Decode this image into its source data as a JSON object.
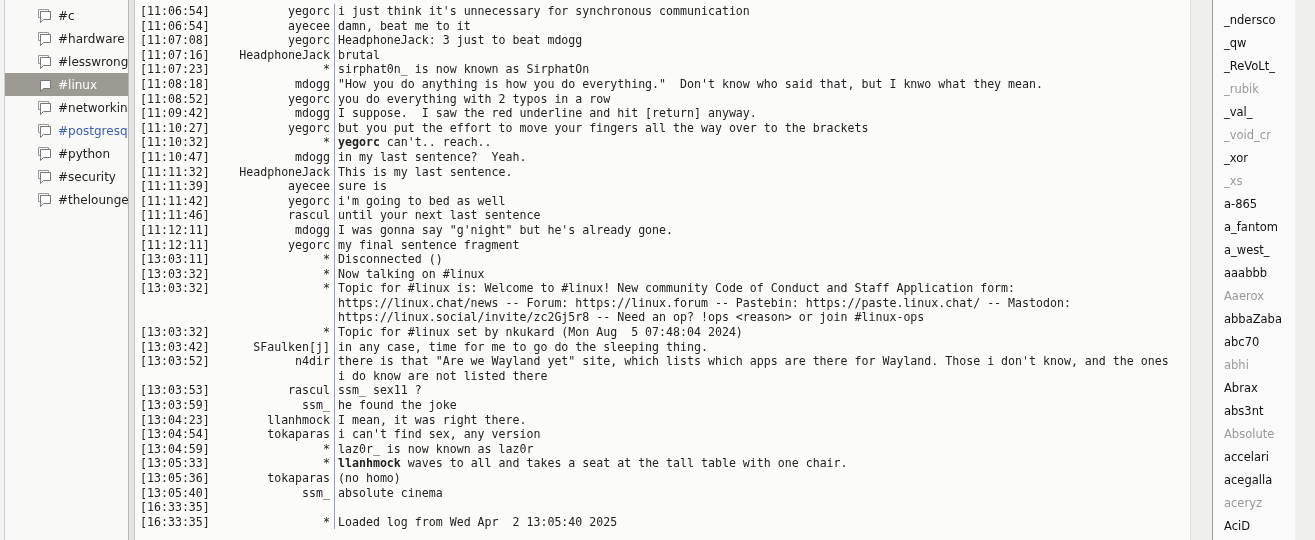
{
  "channels": [
    {
      "name": "#c",
      "selected": false,
      "highlighted": false
    },
    {
      "name": "#hardware",
      "selected": false,
      "highlighted": false
    },
    {
      "name": "#lesswrong",
      "selected": false,
      "highlighted": false
    },
    {
      "name": "#linux",
      "selected": true,
      "highlighted": false
    },
    {
      "name": "#networkin",
      "selected": false,
      "highlighted": false
    },
    {
      "name": "#postgresq",
      "selected": false,
      "highlighted": true
    },
    {
      "name": "#python",
      "selected": false,
      "highlighted": false
    },
    {
      "name": "#security",
      "selected": false,
      "highlighted": false
    },
    {
      "name": "#thelounge",
      "selected": false,
      "highlighted": false
    }
  ],
  "messages": [
    {
      "time": "[11:06:54]",
      "nick": "yegorc",
      "text": "i just think it's unnecessary for synchronous communication"
    },
    {
      "time": "[11:06:54]",
      "nick": "ayecee",
      "text": "damn, beat me to it"
    },
    {
      "time": "[11:07:08]",
      "nick": "yegorc",
      "text": "HeadphoneJack: 3 just to beat mdogg"
    },
    {
      "time": "[11:07:16]",
      "nick": "HeadphoneJack",
      "text": "brutal"
    },
    {
      "time": "[11:07:23]",
      "nick": "*",
      "text": "sirphat0n_ is now known as SirphatOn"
    },
    {
      "time": "[11:08:18]",
      "nick": "mdogg",
      "text": "\"How you do anything is how you do everything.\"  Don't know who said that, but I knwo what they mean."
    },
    {
      "time": "[11:08:52]",
      "nick": "yegorc",
      "text": "you do everything with 2 typos in a row"
    },
    {
      "time": "[11:09:42]",
      "nick": "mdogg",
      "text": "I suppose.  I saw the red underline and hit [return] anyway."
    },
    {
      "time": "[11:10:27]",
      "nick": "yegorc",
      "text": "but you put the effort to move your fingers all the way over to the brackets"
    },
    {
      "time": "[11:10:32]",
      "nick": "*",
      "text": "**yegorc** can't.. reach.."
    },
    {
      "time": "[11:10:47]",
      "nick": "mdogg",
      "text": "in my last sentence?  Yeah."
    },
    {
      "time": "[11:11:32]",
      "nick": "HeadphoneJack",
      "text": "This is my last sentence."
    },
    {
      "time": "[11:11:39]",
      "nick": "ayecee",
      "text": "sure is"
    },
    {
      "time": "[11:11:42]",
      "nick": "yegorc",
      "text": "i'm going to bed as well"
    },
    {
      "time": "[11:11:46]",
      "nick": "rascul",
      "text": "until your next last sentence"
    },
    {
      "time": "[11:12:11]",
      "nick": "mdogg",
      "text": "I was gonna say \"g'night\" but he's already gone."
    },
    {
      "time": "[11:12:11]",
      "nick": "yegorc",
      "text": "my final sentence fragment"
    },
    {
      "time": "[13:03:11]",
      "nick": "*",
      "text": "Disconnected ()"
    },
    {
      "time": "[13:03:32]",
      "nick": "*",
      "text": "Now talking on #linux"
    },
    {
      "time": "[13:03:32]",
      "nick": "*",
      "text": "Topic for #linux is: Welcome to #linux! New community Code of Conduct and Staff Application form: https://linux.chat/news -- Forum: https://linux.forum -- Pastebin: https://paste.linux.chat/ -- Mastodon: https://linux.social/invite/zc2Gj5r8 -- Need an op? !ops <reason> or join #linux-ops"
    },
    {
      "time": "[13:03:32]",
      "nick": "*",
      "text": "Topic for #linux set by nkukard (Mon Aug  5 07:48:04 2024)"
    },
    {
      "time": "[13:03:42]",
      "nick": "SFaulken[j]",
      "text": "in any case, time for me to go do the sleeping thing."
    },
    {
      "time": "[13:03:52]",
      "nick": "n4dir",
      "text": "there is that \"Are we Wayland yet\" site, which lists which apps are there for Wayland. Those i don't know, and the ones i do know are not listed there"
    },
    {
      "time": "[13:03:53]",
      "nick": "rascul",
      "text": "ssm_ sex11 ?"
    },
    {
      "time": "[13:03:59]",
      "nick": "ssm_",
      "text": "he found the joke"
    },
    {
      "time": "[13:04:23]",
      "nick": "llanhmock",
      "text": "I mean, it was right there."
    },
    {
      "time": "[13:04:54]",
      "nick": "tokaparas",
      "text": "i can't find sex, any version"
    },
    {
      "time": "[13:04:59]",
      "nick": "*",
      "text": "laz0r_ is now known as laz0r"
    },
    {
      "time": "[13:05:33]",
      "nick": "*",
      "text": "**llanhmock** waves to all and takes a seat at the tall table with one chair."
    },
    {
      "time": "[13:05:36]",
      "nick": "tokaparas",
      "text": "(no homo)"
    },
    {
      "time": "[13:05:40]",
      "nick": "ssm_",
      "text": "absolute cinema"
    },
    {
      "time": "[16:33:35]"
    },
    {
      "time": "[16:33:35]",
      "nick": "*",
      "text": "Loaded log from Wed Apr  2 13:05:40 2025"
    }
  ],
  "users": [
    {
      "name": "_ndersco",
      "away": false
    },
    {
      "name": "_qw",
      "away": false
    },
    {
      "name": "_ReVoLt_",
      "away": false
    },
    {
      "name": "_rubik",
      "away": true
    },
    {
      "name": "_val_",
      "away": false
    },
    {
      "name": "_void_cr",
      "away": true
    },
    {
      "name": "_xor",
      "away": false
    },
    {
      "name": "_xs",
      "away": true
    },
    {
      "name": "a-865",
      "away": false
    },
    {
      "name": "a_fantom",
      "away": false
    },
    {
      "name": "a_west_",
      "away": false
    },
    {
      "name": "aaabbb",
      "away": false
    },
    {
      "name": "Aaerox",
      "away": true
    },
    {
      "name": "abbaZaba",
      "away": false
    },
    {
      "name": "abc70",
      "away": false
    },
    {
      "name": "abhi",
      "away": true
    },
    {
      "name": "Abrax",
      "away": false
    },
    {
      "name": "abs3nt",
      "away": false
    },
    {
      "name": "Absolute",
      "away": true
    },
    {
      "name": "accelari",
      "away": false
    },
    {
      "name": "acegalla",
      "away": false
    },
    {
      "name": "aceryz",
      "away": true
    },
    {
      "name": "AciD",
      "away": false
    }
  ]
}
